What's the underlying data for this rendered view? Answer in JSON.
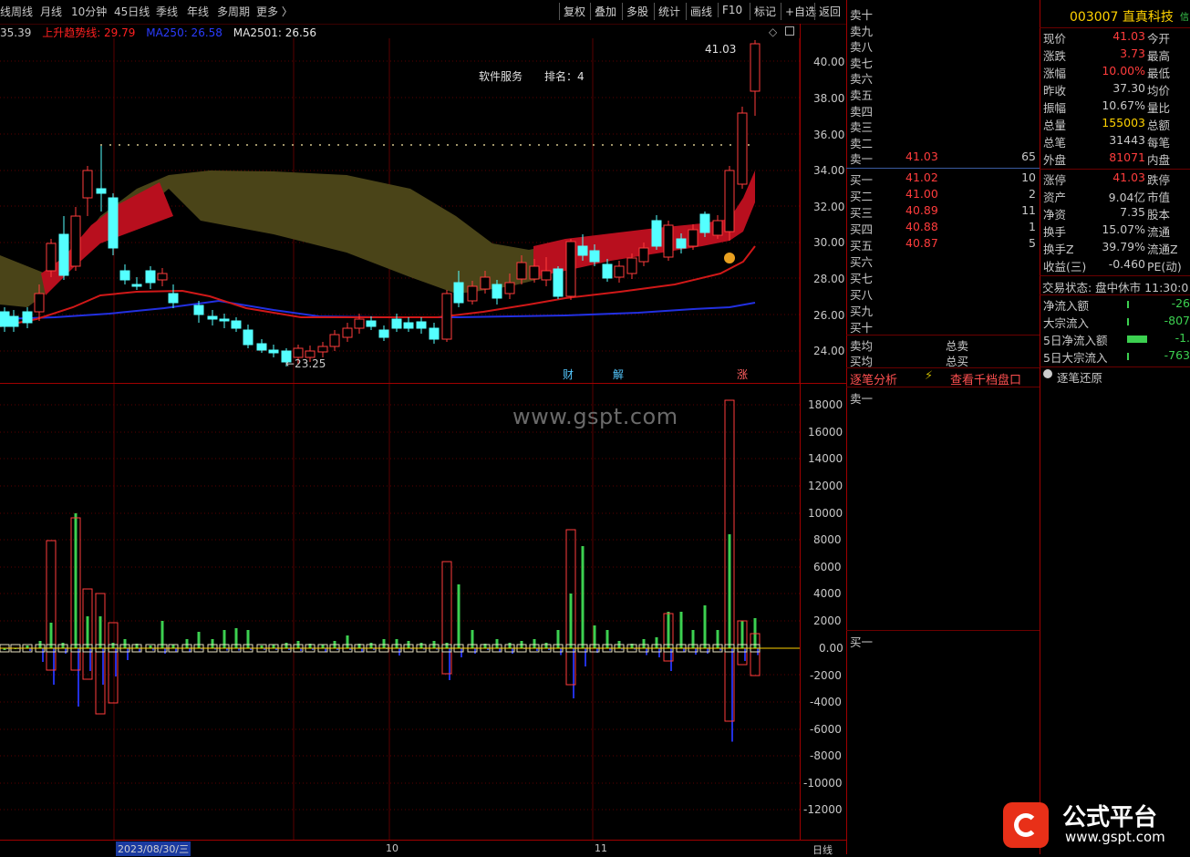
{
  "toolbar": {
    "left_items": [
      "线",
      "周线",
      "月线",
      "10分钟",
      "45日线",
      "季线",
      "年线",
      "多周期",
      "更多 〉"
    ],
    "right_items": [
      "复权",
      "叠加",
      "多股",
      "统计",
      "画线",
      "F10",
      "标记",
      "+自选",
      "返回"
    ]
  },
  "legend": {
    "first": "35.39",
    "rising": "上升趋势线: 29.79",
    "ma250": "MA250: 26.58",
    "ma2501": "MA2501: 26.56"
  },
  "price_chart": {
    "y_ticks": [
      "40.00",
      "38.00",
      "36.00",
      "34.00",
      "32.00",
      "30.00",
      "28.00",
      "26.00",
      "24.00"
    ],
    "high_label": "41.03",
    "low_label": "←23.25",
    "sector": "软件服务",
    "rank": "排名：4",
    "markers": [
      "财",
      "解",
      "涨"
    ]
  },
  "volume_chart": {
    "y_ticks": [
      "18000",
      "16000",
      "14000",
      "12000",
      "10000",
      "8000",
      "6000",
      "4000",
      "2000",
      "0.00",
      "-2000",
      "-4000",
      "-6000",
      "-8000",
      "-10000",
      "-12000"
    ]
  },
  "watermark": "www.gspt.com",
  "x_axis": {
    "labels": [
      "2023/08/30/三",
      "10",
      "11"
    ],
    "period": "日线"
  },
  "order_book": {
    "sells": [
      {
        "label": "卖十",
        "price": "",
        "vol": ""
      },
      {
        "label": "卖九",
        "price": "",
        "vol": ""
      },
      {
        "label": "卖八",
        "price": "",
        "vol": ""
      },
      {
        "label": "卖七",
        "price": "",
        "vol": ""
      },
      {
        "label": "卖六",
        "price": "",
        "vol": ""
      },
      {
        "label": "卖五",
        "price": "",
        "vol": ""
      },
      {
        "label": "卖四",
        "price": "",
        "vol": ""
      },
      {
        "label": "卖三",
        "price": "",
        "vol": ""
      },
      {
        "label": "卖二",
        "price": "",
        "vol": ""
      },
      {
        "label": "卖一",
        "price": "41.03",
        "vol": "65"
      }
    ],
    "buys": [
      {
        "label": "买一",
        "price": "41.02",
        "vol": "10"
      },
      {
        "label": "买二",
        "price": "41.00",
        "vol": "2"
      },
      {
        "label": "买三",
        "price": "40.89",
        "vol": "11"
      },
      {
        "label": "买四",
        "price": "40.88",
        "vol": "1"
      },
      {
        "label": "买五",
        "price": "40.87",
        "vol": "5"
      },
      {
        "label": "买六",
        "price": "",
        "vol": ""
      },
      {
        "label": "买七",
        "price": "",
        "vol": ""
      },
      {
        "label": "买八",
        "price": "",
        "vol": ""
      },
      {
        "label": "买九",
        "price": "",
        "vol": ""
      },
      {
        "label": "买十",
        "price": "",
        "vol": ""
      }
    ],
    "avg_sell": "卖均",
    "avg_buy": "买均",
    "total_sell": "总卖",
    "total_buy": "总买"
  },
  "tick_panel": {
    "tab1": "逐笔分析",
    "tab2": "查看千档盘口",
    "sell1": "卖一",
    "buy1": "买一"
  },
  "stock": {
    "code_name": "003007 直真科技",
    "side_tag": "信"
  },
  "quote": [
    {
      "l": "现价",
      "v": "41.03",
      "c": "#ff3c3c",
      "r": "今开"
    },
    {
      "l": "涨跌",
      "v": "3.73",
      "c": "#ff3c3c",
      "r": "最高"
    },
    {
      "l": "涨幅",
      "v": "10.00%",
      "c": "#ff3c3c",
      "r": "最低"
    },
    {
      "l": "昨收",
      "v": "37.30",
      "c": "#c8c8c8",
      "r": "均价"
    },
    {
      "l": "振幅",
      "v": "10.67%",
      "c": "#c8c8c8",
      "r": "量比"
    },
    {
      "l": "总量",
      "v": "155003",
      "c": "#ffd200",
      "r": "总额"
    },
    {
      "l": "总笔",
      "v": "31443",
      "c": "#c8c8c8",
      "r": "每笔"
    },
    {
      "l": "外盘",
      "v": "81071",
      "c": "#ff3c3c",
      "r": "内盘"
    }
  ],
  "quote2": [
    {
      "l": "涨停",
      "v": "41.03",
      "c": "#ff3c3c",
      "r": "跌停"
    },
    {
      "l": "资产",
      "v": "9.04亿",
      "c": "#c8c8c8",
      "r": "市值"
    },
    {
      "l": "净资",
      "v": "7.35",
      "c": "#c8c8c8",
      "r": "股本"
    },
    {
      "l": "换手",
      "v": "15.07%",
      "c": "#c8c8c8",
      "r": "流通"
    },
    {
      "l": "换手Z",
      "v": "39.79%",
      "c": "#c8c8c8",
      "r": "流通Z"
    },
    {
      "l": "收益(三)",
      "v": "-0.460",
      "c": "#c8c8c8",
      "r": "PE(动)"
    }
  ],
  "trade_state": "交易状态: 盘中休市 11:30:0",
  "flows": [
    {
      "l": "净流入额",
      "v": "-26"
    },
    {
      "l": "大宗流入",
      "v": "-807"
    },
    {
      "l": "5日净流入额",
      "v": "-1."
    },
    {
      "l": "5日大宗流入",
      "v": "-763"
    }
  ],
  "restore_label": "逐笔还原",
  "brand": {
    "title": "公式平台",
    "url": "www.gspt.com"
  },
  "colors": {
    "up": "#ff3c3c",
    "down": "#54ffff",
    "grid": "#6a0000",
    "ma": "#1e2ad8"
  }
}
